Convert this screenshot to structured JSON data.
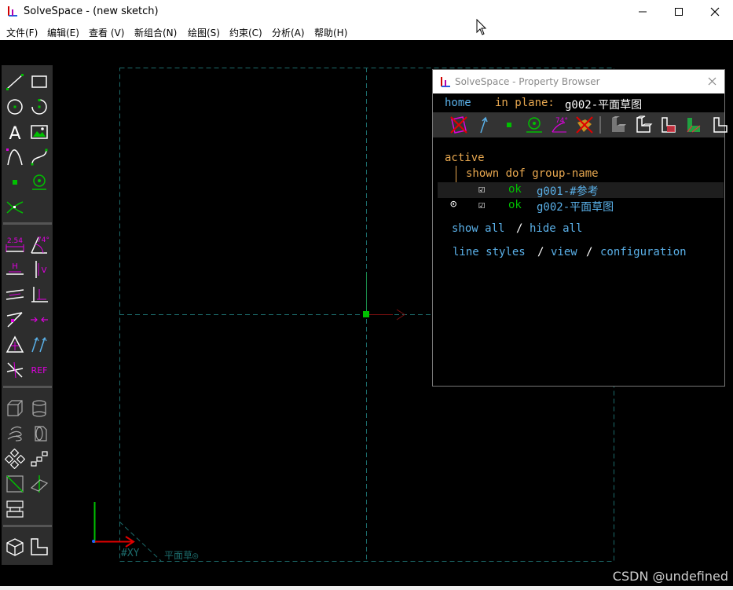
{
  "window": {
    "title": "SolveSpace - (new sketch)",
    "minimize_glyph": "—",
    "maximize_glyph": "☐",
    "close_glyph": "✕"
  },
  "menu": [
    "文件(F)",
    "编辑(E)",
    "查看 (V)",
    "新组合(N)",
    "绘图(S)",
    "约束(C)",
    "分析(A)",
    "帮助(H)"
  ],
  "toolbar": {
    "text_tool_glyph": "A",
    "dimension_label": "2.54",
    "angle_label": "74°",
    "horizontal_label": "H",
    "vertical_label": "V",
    "reference_label": "REF"
  },
  "canvas": {
    "workplane_label": "#XY",
    "group_label": "平面草◎"
  },
  "property_browser": {
    "title": "SolveSpace - Property Browser",
    "close_glyph": "✕",
    "home_link": "home",
    "in_plane_label": "in plane:",
    "in_plane_value": "g002-平面草图",
    "angle_icon_label": "74°",
    "active_label": "active",
    "columns_header": "shown dof group-name",
    "groups": [
      {
        "checked": "☑",
        "dof": "ok",
        "name": "g001-#参考",
        "active_marker": ""
      },
      {
        "checked": "☑",
        "dof": "ok",
        "name": "g002-平面草图",
        "active_marker": "⊙"
      }
    ],
    "show_all": "show all",
    "slash1": "/",
    "hide_all": "hide all",
    "line_styles": "line styles",
    "slash2": "/",
    "view": "view",
    "slash3": "/",
    "configuration": "configuration"
  },
  "colors": {
    "accent_green": "#00c000",
    "magenta": "#e000e0",
    "link_blue": "#5ab0e8",
    "label_orange": "#e8a850",
    "dashed_teal": "#1c6b6b"
  },
  "watermark": "CSDN @undefined"
}
